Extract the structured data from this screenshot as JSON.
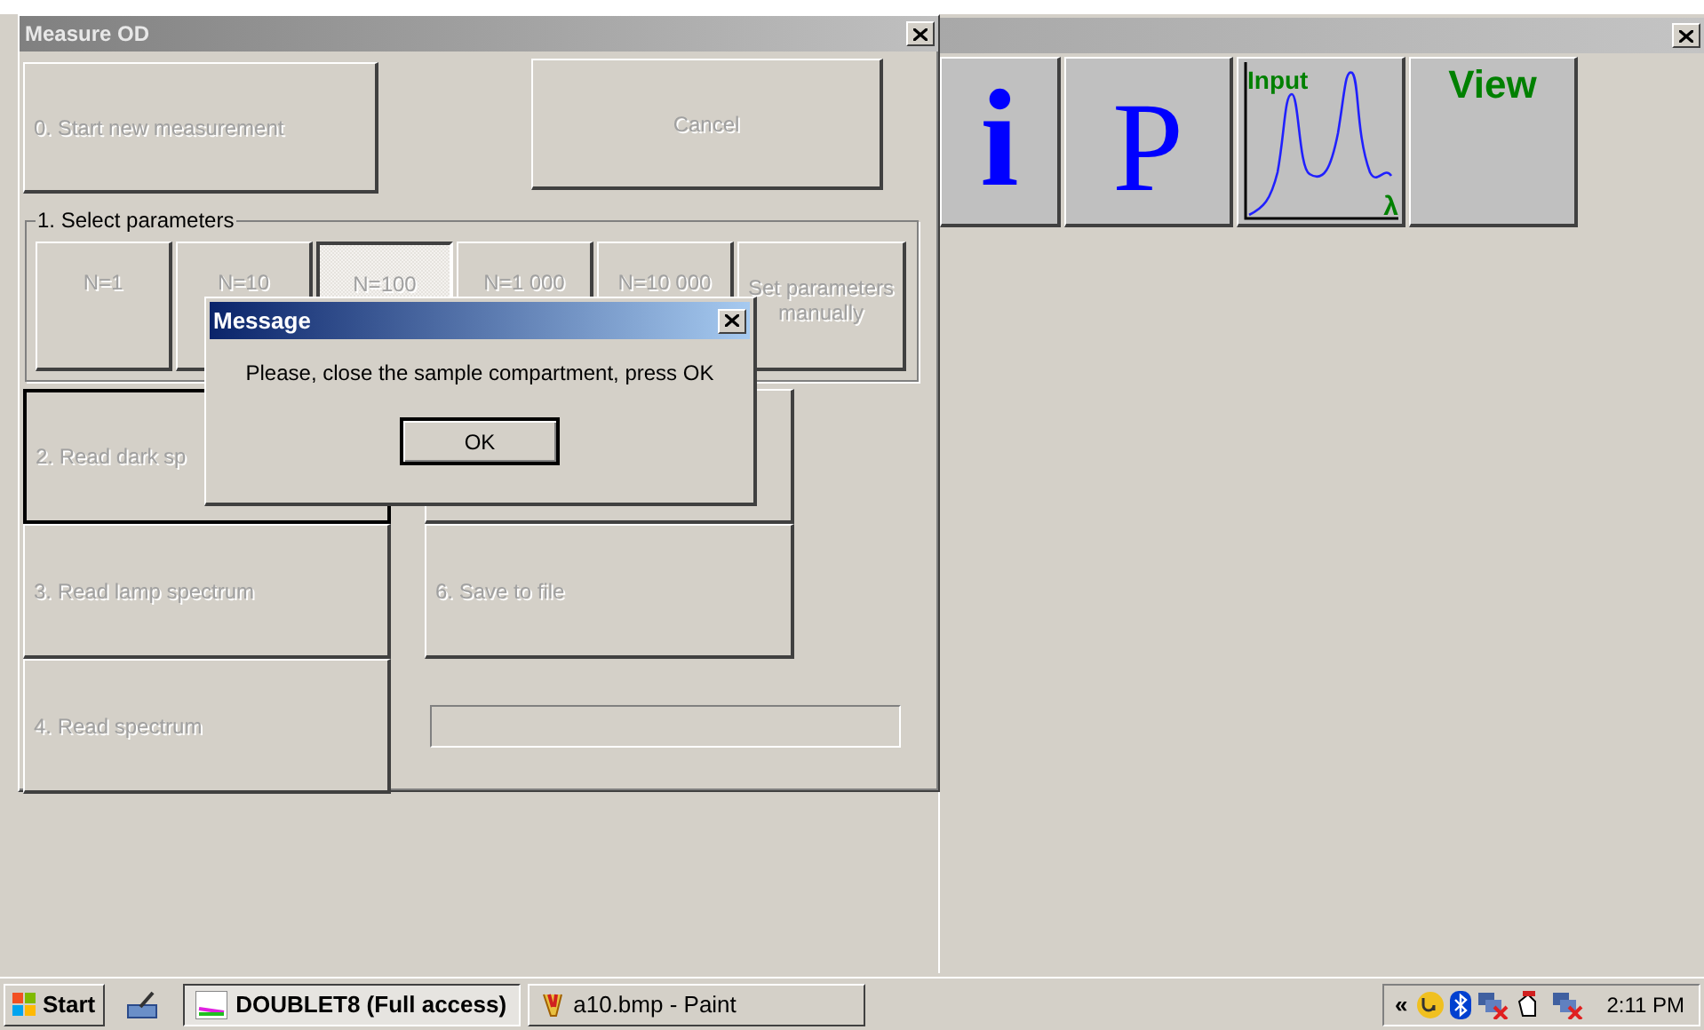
{
  "measure_window": {
    "title": "Measure OD",
    "top_buttons": [
      {
        "label": "0. Start new measurement",
        "disabled": true
      },
      {
        "label": "Cancel",
        "disabled": true
      }
    ],
    "parameters": {
      "label": "1. Select parameters",
      "options": [
        {
          "label": "N=1",
          "selected": false,
          "disabled": true
        },
        {
          "label": "N=10",
          "selected": false,
          "disabled": true
        },
        {
          "label": "N=100",
          "selected": true,
          "disabled": true
        },
        {
          "label": "N=1 000",
          "selected": false,
          "disabled": true
        },
        {
          "label": "N=10 000",
          "selected": false,
          "disabled": true
        },
        {
          "label": "Set parameters manually",
          "selected": false,
          "disabled": true
        }
      ]
    },
    "steps": [
      {
        "label": "2. Read dark sp",
        "disabled": true
      },
      {
        "label": "3. Read lamp spectrum",
        "disabled": true
      },
      {
        "label": "6. Save to file",
        "disabled": true
      },
      {
        "label": "4. Read spectrum",
        "disabled": true
      }
    ]
  },
  "main_window": {
    "toolbar": [
      {
        "kind": "info",
        "label": "i"
      },
      {
        "kind": "letter",
        "label": "P"
      },
      {
        "kind": "graph",
        "label": "Input",
        "axis_label": "λ"
      },
      {
        "kind": "text",
        "label": "View"
      }
    ]
  },
  "message_dialog": {
    "title": "Message",
    "text": "Please, close the sample compartment, press OK",
    "button": "OK"
  },
  "taskbar": {
    "start": "Start",
    "tasks": [
      {
        "label": "DOUBLET8 (Full access)",
        "selected": true
      },
      {
        "label": "a10.bmp - Paint",
        "selected": false
      }
    ],
    "tray": {
      "chevron": "«",
      "time": "2:11 PM"
    }
  }
}
